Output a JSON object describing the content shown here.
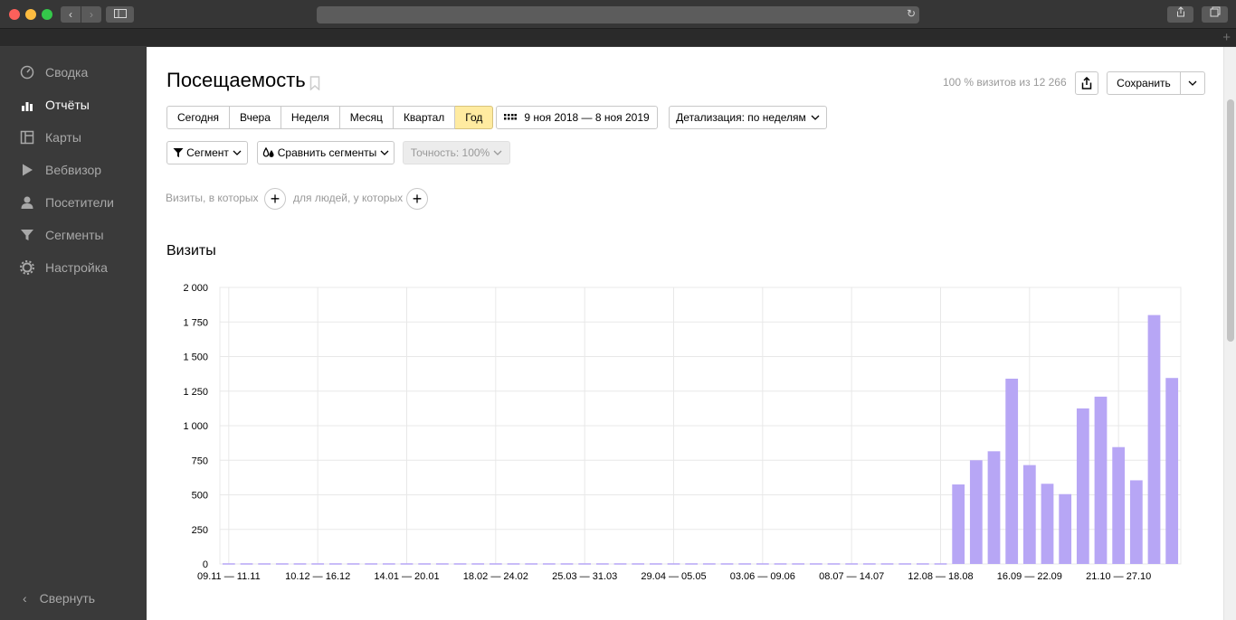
{
  "browser": {
    "back_glyph": "‹",
    "forward_glyph": "›",
    "sidebar_toggle_icon": "sidebar-icon",
    "reload_glyph": "↻",
    "newtab_glyph": "+"
  },
  "sidebar": {
    "items": [
      {
        "label": "Сводка",
        "icon": "dashboard-icon",
        "active": false
      },
      {
        "label": "Отчёты",
        "icon": "reports-icon",
        "active": true
      },
      {
        "label": "Карты",
        "icon": "maps-icon",
        "active": false
      },
      {
        "label": "Вебвизор",
        "icon": "play-icon",
        "active": false
      },
      {
        "label": "Посетители",
        "icon": "user-icon",
        "active": false
      },
      {
        "label": "Сегменты",
        "icon": "filter-icon",
        "active": false
      },
      {
        "label": "Настройка",
        "icon": "gear-icon",
        "active": false
      }
    ],
    "collapse_glyph": "‹",
    "collapse_label": "Свернуть"
  },
  "header": {
    "title": "Посещаемость",
    "visits_share": "100 % визитов из 12 266",
    "save_label": "Сохранить"
  },
  "periods": [
    "Сегодня",
    "Вчера",
    "Неделя",
    "Месяц",
    "Квартал",
    "Год"
  ],
  "active_period": "Год",
  "date_range": "9 ноя 2018 — 8 ноя 2019",
  "detail": "Детализация: по неделям",
  "segment_label": "Сегмент",
  "compare_label": "Сравнить сегменты",
  "accuracy_label": "Точность: 100%",
  "conditions": {
    "visits_text": "Визиты, в которых",
    "people_text": "для людей, у которых",
    "plus_glyph": "+"
  },
  "chart_data": {
    "type": "bar",
    "title": "Визиты",
    "ylim": [
      0,
      2000
    ],
    "yticks": [
      0,
      250,
      500,
      750,
      1000,
      1250,
      1500,
      1750,
      2000
    ],
    "ytick_labels": [
      "0",
      "250",
      "500",
      "750",
      "1 000",
      "1 250",
      "1 500",
      "1 750",
      "2 000"
    ],
    "xtick_labels": [
      "09.11 — 11.11",
      "10.12 — 16.12",
      "14.01 — 20.01",
      "18.02 — 24.02",
      "25.03 — 31.03",
      "29.04 — 05.05",
      "03.06 — 09.06",
      "08.07 — 14.07",
      "12.08 — 18.08",
      "16.09 — 22.09",
      "21.10 — 27.10"
    ],
    "xtick_indices": [
      0,
      5,
      10,
      15,
      20,
      25,
      30,
      35,
      40,
      45,
      50
    ],
    "values": [
      5,
      5,
      5,
      5,
      5,
      5,
      5,
      5,
      5,
      5,
      5,
      5,
      5,
      5,
      5,
      5,
      5,
      5,
      5,
      5,
      5,
      5,
      5,
      5,
      5,
      5,
      5,
      5,
      5,
      5,
      5,
      5,
      5,
      5,
      5,
      5,
      5,
      5,
      5,
      5,
      5,
      575,
      750,
      815,
      1340,
      715,
      580,
      505,
      1125,
      1210,
      845,
      605,
      1800,
      1345
    ],
    "bar_color": "#b7a6f5",
    "grid": true
  },
  "colors": {
    "sidebar_bg": "#3a3a3a",
    "active_period_bg": "#ffeba0"
  }
}
